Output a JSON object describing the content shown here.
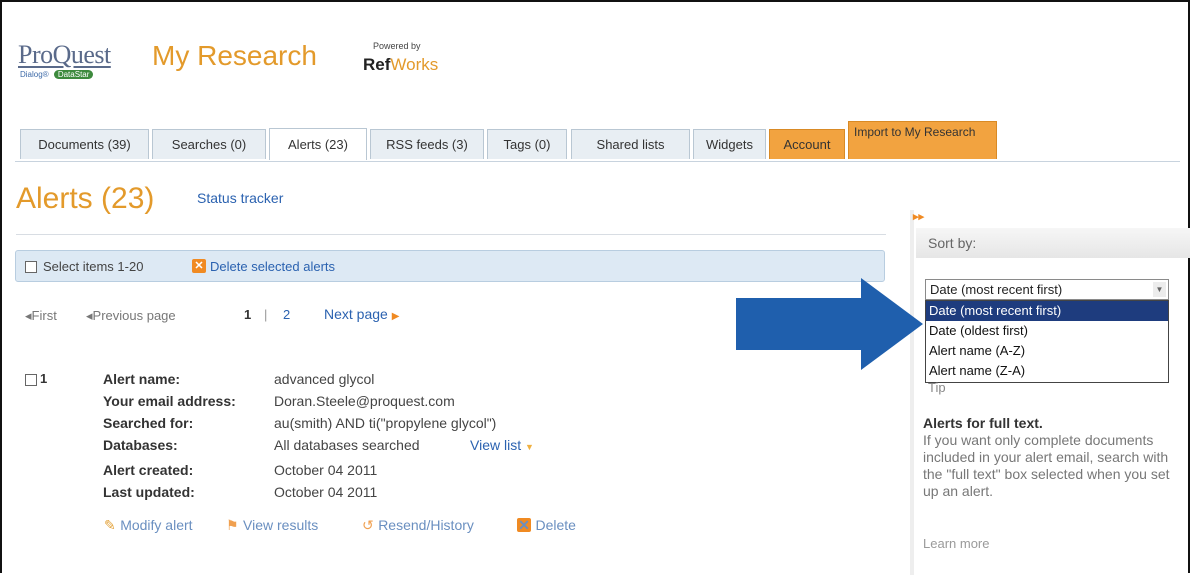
{
  "header": {
    "logo_main": "ProQuest",
    "logo_sub_dialog": "Dialog",
    "logo_sub_datastar": "DataStar",
    "app_title": "My Research",
    "powered_by": "Powered by",
    "refworks_ref": "Ref",
    "refworks_works": "Works"
  },
  "tabs": [
    {
      "label": "Documents (39)"
    },
    {
      "label": "Searches (0)"
    },
    {
      "label": "Alerts (23)"
    },
    {
      "label": "RSS feeds (3)"
    },
    {
      "label": "Tags (0)"
    },
    {
      "label": "Shared lists"
    },
    {
      "label": "Widgets"
    },
    {
      "label": "Account"
    },
    {
      "label": "Import to My Research"
    }
  ],
  "page": {
    "title": "Alerts (23)",
    "status_tracker": "Status tracker"
  },
  "actionbar": {
    "select_items": "Select items 1-20",
    "delete_selected": "Delete selected alerts"
  },
  "pager": {
    "first": "First",
    "previous": "Previous page",
    "page_1": "1",
    "separator": "|",
    "page_2": "2",
    "next": "Next page"
  },
  "alert": {
    "number": "1",
    "fields": [
      {
        "label": "Alert name:",
        "value": "advanced glycol"
      },
      {
        "label": "Your email address:",
        "value": "Doran.Steele@proquest.com"
      },
      {
        "label": "Searched for:",
        "value": "au(smith) AND ti(\"propylene glycol\")"
      },
      {
        "label": "Databases:",
        "value": "All databases searched"
      },
      {
        "label": "Alert created:",
        "value": "October 04 2011"
      },
      {
        "label": "Last updated:",
        "value": "October 04 2011"
      }
    ],
    "view_list": "View list",
    "actions": {
      "modify": "Modify alert",
      "view_results": "View results",
      "resend": "Resend/History",
      "delete": "Delete"
    }
  },
  "sidebar": {
    "sort_by": "Sort by:",
    "selected": "Date (most recent first)",
    "options": [
      "Date (most recent first)",
      "Date (oldest first)",
      "Alert name (A-Z)",
      "Alert name (Z-A)"
    ],
    "tip_label": "Tip",
    "tip_title": "Alerts for full text.",
    "tip_body": "If you want only complete documents included in your alert email, search with the \"full text\" box selected when you set up an alert.",
    "learn_more": "Learn more"
  },
  "colors": {
    "accent_orange": "#e39a2b",
    "link_blue": "#2b62b0",
    "arrow_blue": "#1f5fad",
    "selected_option": "#1e3c7e"
  }
}
